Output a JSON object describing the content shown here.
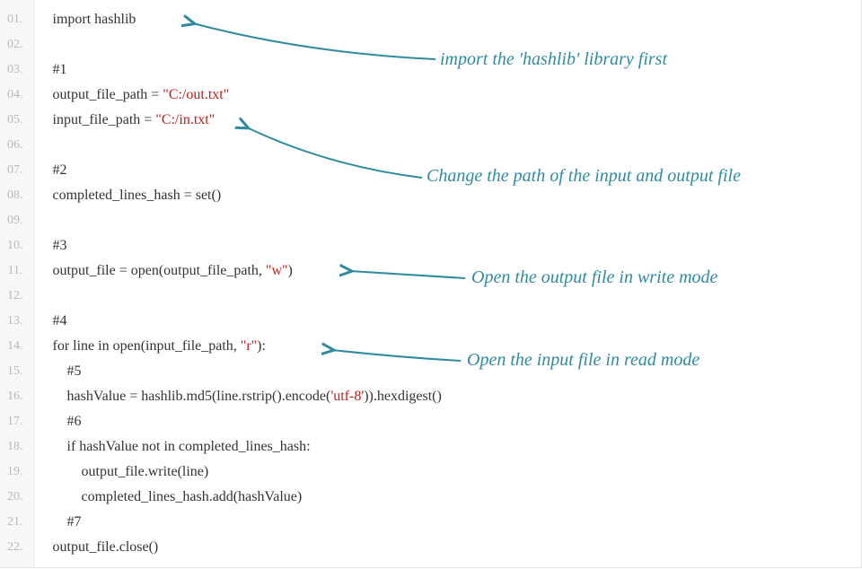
{
  "gutter": [
    "01.",
    "02.",
    "03.",
    "04.",
    "05.",
    "06.",
    "07.",
    "08.",
    "09.",
    "10.",
    "11.",
    "12.",
    "13.",
    "14.",
    "15.",
    "16.",
    "17.",
    "18.",
    "19.",
    "20.",
    "21.",
    "22."
  ],
  "code": {
    "l1": "import hashlib",
    "l3": "#1",
    "l4a": "output_file_path = ",
    "l4b": "\"C:/out.txt\"",
    "l5a": "input_file_path = ",
    "l5b": "\"C:/in.txt\"",
    "l7": "#2",
    "l8": "completed_lines_hash = set()",
    "l10": "#3",
    "l11a": "output_file = open(output_file_path, ",
    "l11b": "\"w\"",
    "l11c": ")",
    "l13": "#4",
    "l14a": "for line in open(input_file_path, ",
    "l14b": "\"r\"",
    "l14c": "):",
    "l15": "#5",
    "l16a": "hashValue = hashlib.md5(line.rstrip().encode(",
    "l16b": "'utf-8'",
    "l16c": ")).hexdigest()",
    "l17": "#6",
    "l18": "if hashValue not in completed_lines_hash:",
    "l19": "output_file.write(line)",
    "l20": "completed_lines_hash.add(hashValue)",
    "l21": "#7",
    "l22": "output_file.close()"
  },
  "annotations": {
    "a1": "import the 'hashlib' library first",
    "a2": "Change the path of the input and output file",
    "a3": "Open the output file in write mode",
    "a4": "Open the input file in read mode"
  },
  "colors": {
    "annotation": "#2f8ba0",
    "string": "#c41a16",
    "gutter_bg": "#f7f7f7",
    "gutter_text": "#bbbbbb"
  }
}
